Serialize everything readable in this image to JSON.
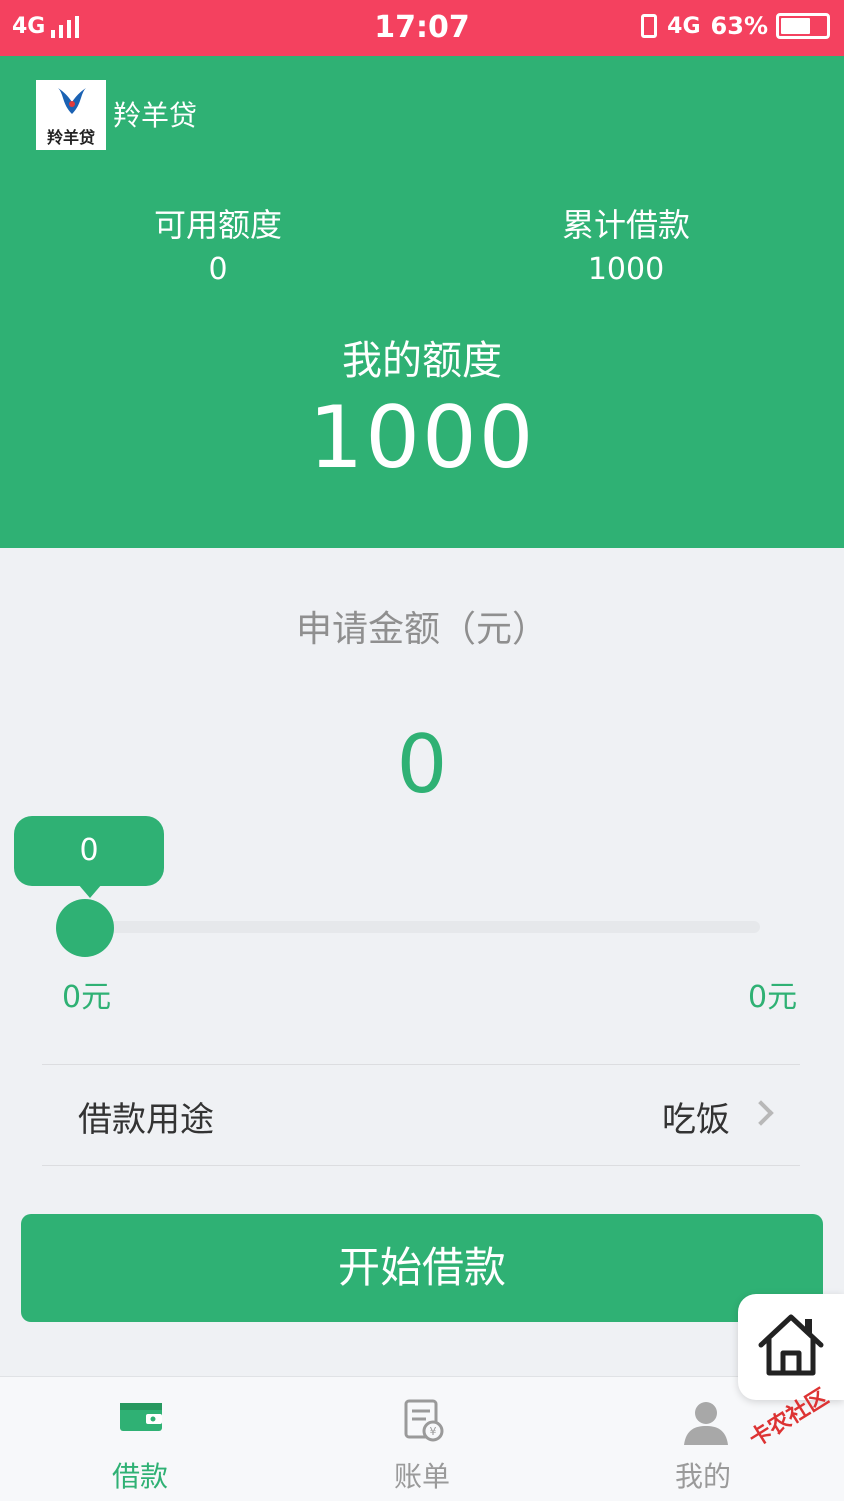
{
  "status_bar": {
    "network": "4G",
    "time": "17:07",
    "network_right": "4G",
    "battery": "63%"
  },
  "header": {
    "logo_text": "羚羊贷",
    "app_name": "羚羊贷",
    "available_label": "可用额度",
    "available_value": "0",
    "total_label": "累计借款",
    "total_value": "1000",
    "quota_label": "我的额度",
    "quota_value": "1000"
  },
  "apply": {
    "label": "申请金额（元）",
    "value": "0",
    "slider_bubble": "0",
    "slider_position": 0,
    "range_min": "0元",
    "range_max": "0元"
  },
  "purpose": {
    "label": "借款用途",
    "value": "吃饭"
  },
  "start_button": "开始借款",
  "bottom_nav": {
    "items": [
      {
        "label": "借款",
        "icon": "wallet-icon",
        "active": true
      },
      {
        "label": "账单",
        "icon": "bill-icon",
        "active": false
      },
      {
        "label": "我的",
        "icon": "person-icon",
        "active": false
      }
    ]
  },
  "watermark": "卡农社区",
  "colors": {
    "status_bar": "#f4415f",
    "accent": "#2fb174",
    "background": "#eff1f4"
  }
}
